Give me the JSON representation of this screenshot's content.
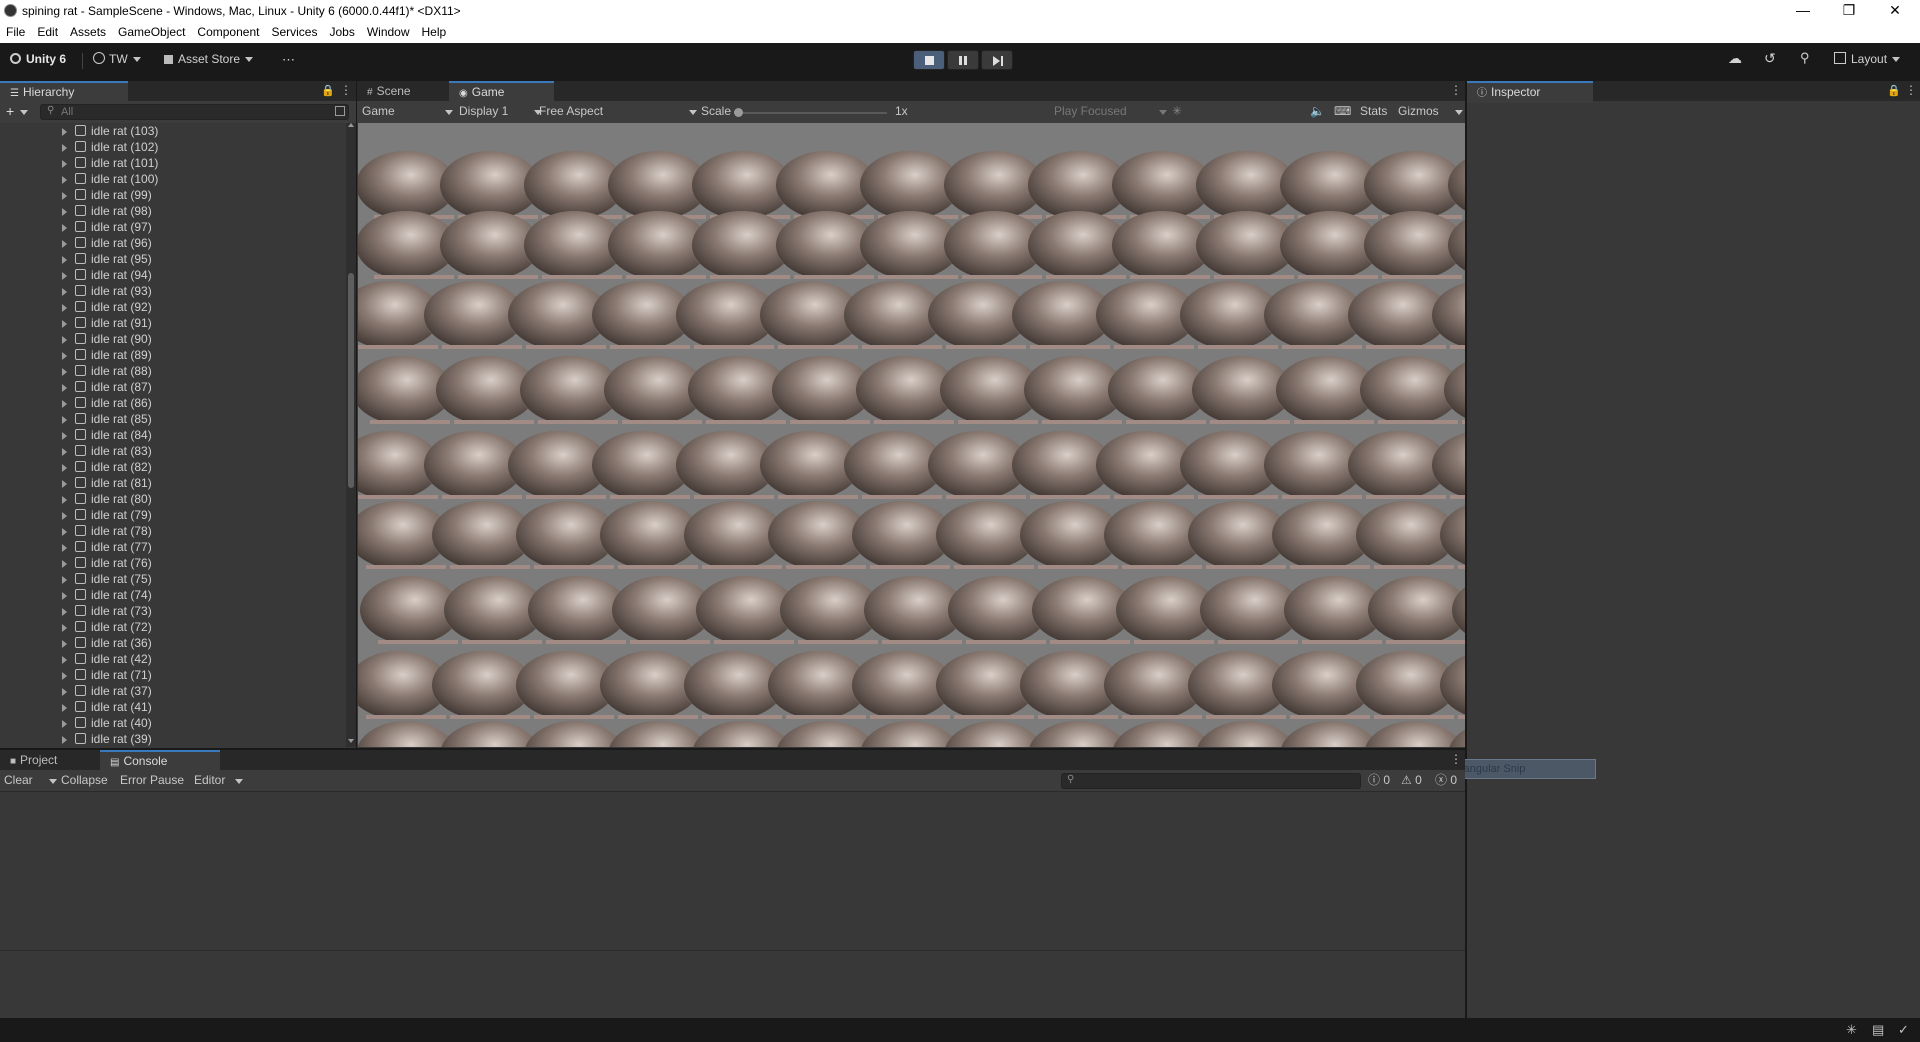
{
  "window": {
    "title": "spining rat - SampleScene - Windows, Mac, Linux - Unity 6 (6000.0.44f1)* <DX11>",
    "controls": [
      "minimize",
      "restore",
      "close"
    ]
  },
  "menu": [
    "File",
    "Edit",
    "Assets",
    "GameObject",
    "Component",
    "Services",
    "Jobs",
    "Window",
    "Help"
  ],
  "toolbar": {
    "brand": "Unity 6",
    "account": "TW",
    "asset_store": "Asset Store",
    "layout": "Layout"
  },
  "hierarchy": {
    "tab": "Hierarchy",
    "search_placeholder": "All",
    "items": [
      "idle rat (103)",
      "idle rat (102)",
      "idle rat (101)",
      "idle rat (100)",
      "idle rat (99)",
      "idle rat (98)",
      "idle rat (97)",
      "idle rat (96)",
      "idle rat (95)",
      "idle rat (94)",
      "idle rat (93)",
      "idle rat (92)",
      "idle rat (91)",
      "idle rat (90)",
      "idle rat (89)",
      "idle rat (88)",
      "idle rat (87)",
      "idle rat (86)",
      "idle rat (85)",
      "idle rat (84)",
      "idle rat (83)",
      "idle rat (82)",
      "idle rat (81)",
      "idle rat (80)",
      "idle rat (79)",
      "idle rat (78)",
      "idle rat (77)",
      "idle rat (76)",
      "idle rat (75)",
      "idle rat (74)",
      "idle rat (73)",
      "idle rat (72)",
      "idle rat (36)",
      "idle rat (42)",
      "idle rat (71)",
      "idle rat (37)",
      "idle rat (41)",
      "idle rat (40)",
      "idle rat (39)"
    ]
  },
  "game": {
    "tabs": [
      "Scene",
      "Game"
    ],
    "view_select": "Game",
    "display_select": "Display 1",
    "aspect_select": "Free Aspect",
    "scale_label": "Scale",
    "scale_value": "1x",
    "play_mode": "Play Focused",
    "stats": "Stats",
    "gizmos": "Gizmos"
  },
  "inspector": {
    "tab": "Inspector"
  },
  "console": {
    "tabs": [
      "Project",
      "Console"
    ],
    "clear": "Clear",
    "collapse": "Collapse",
    "error_pause": "Error Pause",
    "editor": "Editor",
    "counts": {
      "log": "0",
      "warning": "0",
      "error": "0"
    },
    "overlay_hint": "Rectangular Snip"
  },
  "colors": {
    "accent": "#3a79bb",
    "panel": "#383838",
    "background": "#191919",
    "game_bg": "#7c7c7c"
  }
}
